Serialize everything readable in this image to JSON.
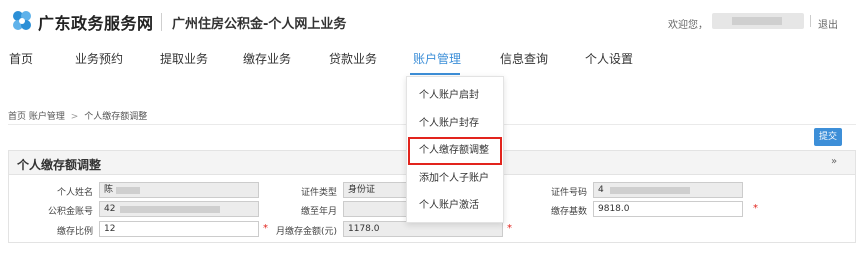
{
  "header": {
    "brand": "广东政务服务网",
    "subtitle": "广州住房公积金-个人网上业务",
    "welcome": "欢迎您，",
    "logout": "退出"
  },
  "nav": {
    "items": [
      "首页",
      "业务预约",
      "提取业务",
      "缴存业务",
      "贷款业务",
      "账户管理",
      "信息查询",
      "个人设置"
    ],
    "active": "账户管理"
  },
  "dropdown": {
    "items": [
      "个人账户启封",
      "个人账户封存",
      "个人缴存额调整",
      "添加个人子账户",
      "个人账户激活"
    ],
    "highlighted": "个人缴存额调整"
  },
  "breadcrumb": {
    "home": "首页",
    "section": "账户管理",
    "sep": ">",
    "current": "个人缴存额调整"
  },
  "submit_label": "提交",
  "panel": {
    "title": "个人缴存额调整",
    "collapse_icon": "double-chevron-down-icon",
    "fields": {
      "name_label": "个人姓名",
      "name_value": "陈",
      "id_type_label": "证件类型",
      "id_type_value": "身份证",
      "id_no_label": "证件号码",
      "id_no_value": "4",
      "account_label": "公积金账号",
      "account_value": "42",
      "paid_until_label": "缴至年月",
      "paid_until_value": "",
      "base_label": "缴存基数",
      "base_value": "9818.0",
      "ratio_label": "缴存比例",
      "ratio_value": "12",
      "monthly_label": "月缴存金额(元)",
      "monthly_value": "1178.0",
      "required_mark": "*"
    }
  },
  "colors": {
    "accent": "#3d8fd8",
    "highlight_border": "#e2241d",
    "required": "#e2241d",
    "logo": "#2b8fd6"
  }
}
